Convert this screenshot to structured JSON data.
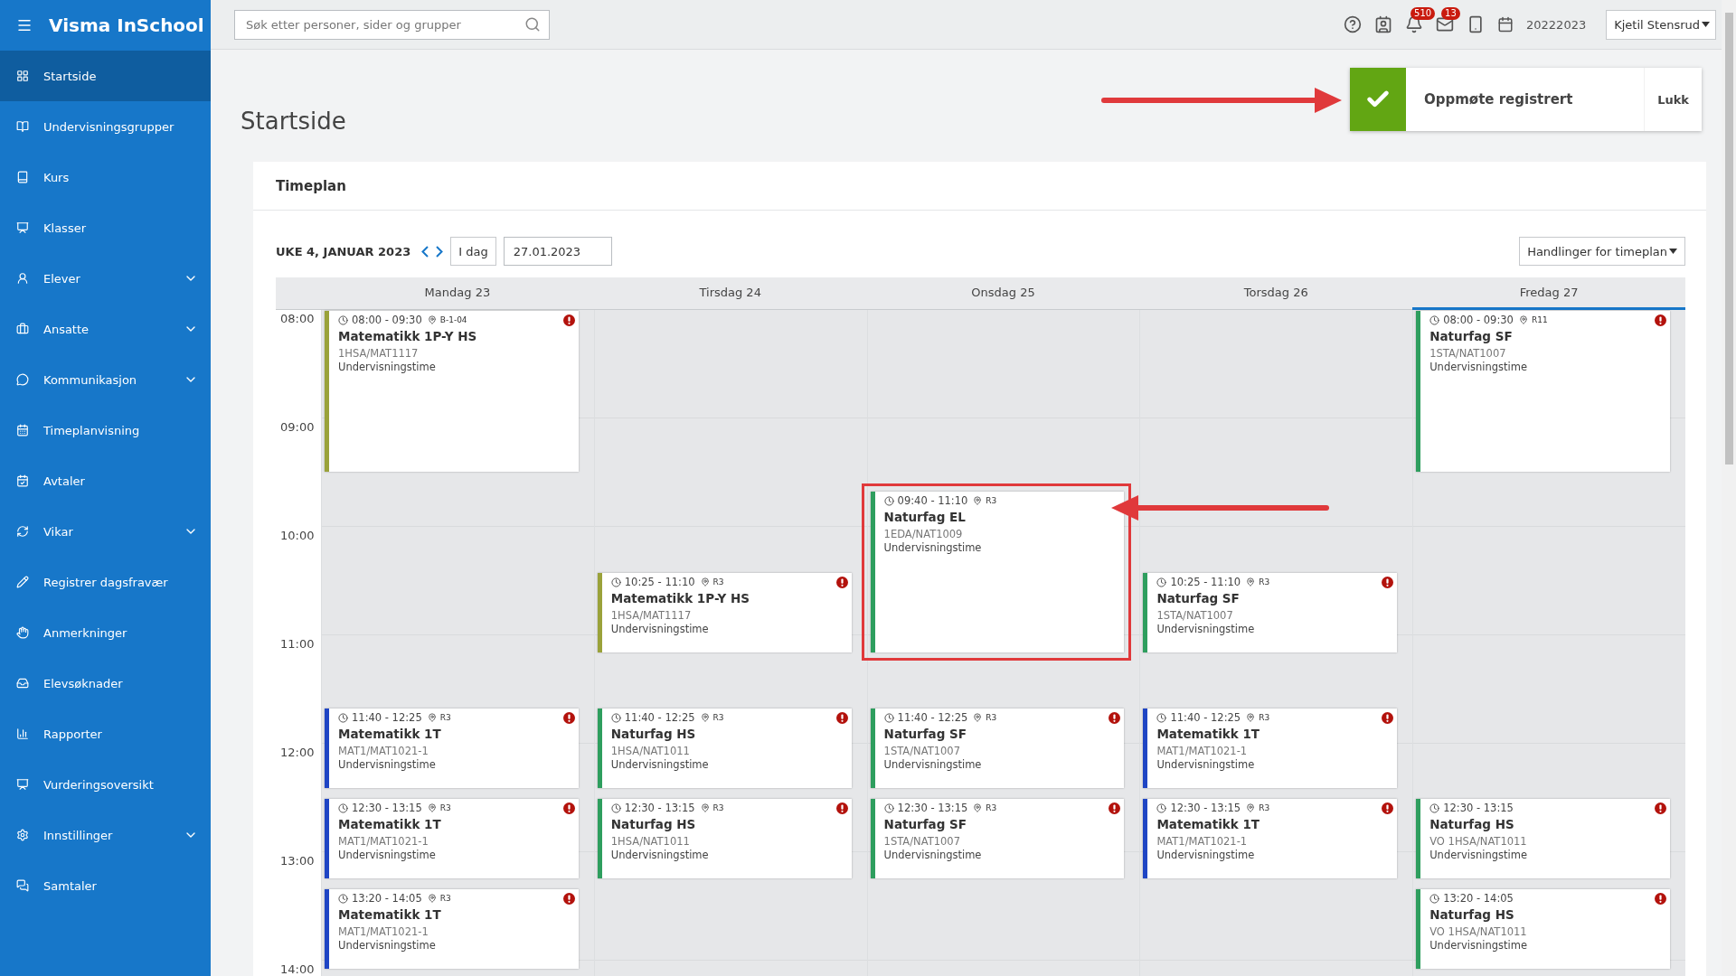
{
  "sidebar": {
    "title": "Visma InSchool",
    "items": [
      {
        "label": "Startside",
        "selected": true,
        "expandable": false
      },
      {
        "label": "Undervisningsgrupper",
        "selected": false,
        "expandable": false
      },
      {
        "label": "Kurs",
        "selected": false,
        "expandable": false
      },
      {
        "label": "Klasser",
        "selected": false,
        "expandable": false
      },
      {
        "label": "Elever",
        "selected": false,
        "expandable": true
      },
      {
        "label": "Ansatte",
        "selected": false,
        "expandable": true
      },
      {
        "label": "Kommunikasjon",
        "selected": false,
        "expandable": true
      },
      {
        "label": "Timeplanvisning",
        "selected": false,
        "expandable": false
      },
      {
        "label": "Avtaler",
        "selected": false,
        "expandable": false
      },
      {
        "label": "Vikar",
        "selected": false,
        "expandable": true
      },
      {
        "label": "Registrer dagsfravær",
        "selected": false,
        "expandable": false
      },
      {
        "label": "Anmerkninger",
        "selected": false,
        "expandable": false
      },
      {
        "label": "Elevsøknader",
        "selected": false,
        "expandable": false
      },
      {
        "label": "Rapporter",
        "selected": false,
        "expandable": false
      },
      {
        "label": "Vurderingsoversikt",
        "selected": false,
        "expandable": false
      },
      {
        "label": "Innstillinger",
        "selected": false,
        "expandable": true
      },
      {
        "label": "Samtaler",
        "selected": false,
        "expandable": false
      }
    ]
  },
  "header": {
    "search": {
      "placeholder": "Søk etter personer, sider og grupper"
    },
    "notifications": "510",
    "messages": "13",
    "school_year": "20222023",
    "user": "Kjetil Stensrud"
  },
  "toast": {
    "message": "Oppmøte registrert",
    "close": "Lukk"
  },
  "page_title": "Startside",
  "timetable": {
    "title": "Timeplan",
    "week": "UKE 4, JANUAR 2023",
    "today_button": "I dag",
    "date": "27.01.2023",
    "actions": "Handlinger for timeplan",
    "hours": [
      "08:00",
      "09:00",
      "10:00",
      "11:00",
      "12:00",
      "13:00",
      "14:00"
    ],
    "days": [
      {
        "label": "Mandag 23",
        "selected": false,
        "events": [
          {
            "time": "08:00 - 09:30",
            "room": "B-1-04",
            "title": "Matematikk 1P-Y HS",
            "code": "1HSA/MAT1117",
            "type": "Undervisningstime",
            "color": "#9aa23a",
            "alert": true,
            "highlighted": false
          },
          {
            "time": "11:40 - 12:25",
            "room": "R3",
            "title": "Matematikk 1T",
            "code": "MAT1/MAT1021-1",
            "type": "Undervisningstime",
            "color": "#1f45c4",
            "alert": true,
            "highlighted": false
          },
          {
            "time": "12:30 - 13:15",
            "room": "R3",
            "title": "Matematikk 1T",
            "code": "MAT1/MAT1021-1",
            "type": "Undervisningstime",
            "color": "#1f45c4",
            "alert": true,
            "highlighted": false
          },
          {
            "time": "13:20 - 14:05",
            "room": "R3",
            "title": "Matematikk 1T",
            "code": "MAT1/MAT1021-1",
            "type": "Undervisningstime",
            "color": "#1f45c4",
            "alert": true,
            "highlighted": false
          }
        ]
      },
      {
        "label": "Tirsdag 24",
        "selected": false,
        "events": [
          {
            "time": "10:25 - 11:10",
            "room": "R3",
            "title": "Matematikk 1P-Y HS",
            "code": "1HSA/MAT1117",
            "type": "Undervisningstime",
            "color": "#9aa23a",
            "alert": true,
            "highlighted": false
          },
          {
            "time": "11:40 - 12:25",
            "room": "R3",
            "title": "Naturfag HS",
            "code": "1HSA/NAT1011",
            "type": "Undervisningstime",
            "color": "#2e9e5e",
            "alert": true,
            "highlighted": false
          },
          {
            "time": "12:30 - 13:15",
            "room": "R3",
            "title": "Naturfag HS",
            "code": "1HSA/NAT1011",
            "type": "Undervisningstime",
            "color": "#2e9e5e",
            "alert": true,
            "highlighted": false
          }
        ]
      },
      {
        "label": "Onsdag 25",
        "selected": false,
        "events": [
          {
            "time": "09:40 - 11:10",
            "room": "R3",
            "title": "Naturfag EL",
            "code": "1EDA/NAT1009",
            "type": "Undervisningstime",
            "color": "#2e9e5e",
            "alert": false,
            "highlighted": true
          },
          {
            "time": "11:40 - 12:25",
            "room": "R3",
            "title": "Naturfag SF",
            "code": "1STA/NAT1007",
            "type": "Undervisningstime",
            "color": "#2e9e5e",
            "alert": true,
            "highlighted": false
          },
          {
            "time": "12:30 - 13:15",
            "room": "R3",
            "title": "Naturfag SF",
            "code": "1STA/NAT1007",
            "type": "Undervisningstime",
            "color": "#2e9e5e",
            "alert": true,
            "highlighted": false
          }
        ]
      },
      {
        "label": "Torsdag 26",
        "selected": false,
        "events": [
          {
            "time": "10:25 - 11:10",
            "room": "R3",
            "title": "Naturfag SF",
            "code": "1STA/NAT1007",
            "type": "Undervisningstime",
            "color": "#2e9e5e",
            "alert": true,
            "highlighted": false
          },
          {
            "time": "11:40 - 12:25",
            "room": "R3",
            "title": "Matematikk 1T",
            "code": "MAT1/MAT1021-1",
            "type": "Undervisningstime",
            "color": "#1f45c4",
            "alert": true,
            "highlighted": false
          },
          {
            "time": "12:30 - 13:15",
            "room": "R3",
            "title": "Matematikk 1T",
            "code": "MAT1/MAT1021-1",
            "type": "Undervisningstime",
            "color": "#1f45c4",
            "alert": true,
            "highlighted": false
          }
        ]
      },
      {
        "label": "Fredag 27",
        "selected": true,
        "events": [
          {
            "time": "08:00 - 09:30",
            "room": "R11",
            "title": "Naturfag SF",
            "code": "1STA/NAT1007",
            "type": "Undervisningstime",
            "color": "#2e9e5e",
            "alert": true,
            "highlighted": false
          },
          {
            "time": "12:30 - 13:15",
            "title": "Naturfag HS",
            "code": "VO 1HSA/NAT1011",
            "type": "Undervisningstime",
            "color": "#2e9e5e",
            "alert": true,
            "highlighted": false
          },
          {
            "time": "13:20 - 14:05",
            "title": "Naturfag HS",
            "code": "VO 1HSA/NAT1011",
            "type": "Undervisningstime",
            "color": "#2e9e5e",
            "alert": true,
            "highlighted": false
          }
        ]
      }
    ]
  }
}
